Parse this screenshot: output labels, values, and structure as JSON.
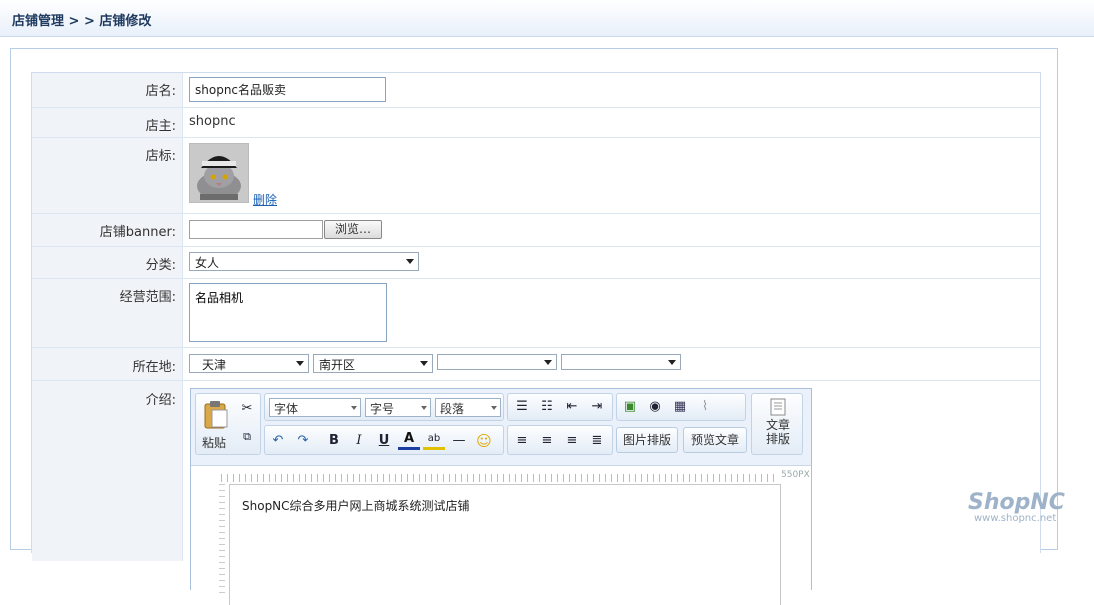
{
  "breadcrumb": "店铺管理 > > 店铺修改",
  "form": {
    "store_name": {
      "label": "店名:",
      "value": "shopnc名品贩卖"
    },
    "owner": {
      "label": "店主:",
      "value": "shopnc"
    },
    "logo": {
      "label": "店标:",
      "delete_link": "删除"
    },
    "banner": {
      "label": "店铺banner:",
      "browse_label": "浏览…"
    },
    "category": {
      "label": "分类:",
      "selected": "女人"
    },
    "scope": {
      "label": "经营范围:",
      "value": "名品相机"
    },
    "location": {
      "label": "所在地:",
      "province": "天津",
      "district": "南开区",
      "sub1": "",
      "sub2": ""
    },
    "intro": {
      "label": "介绍:"
    }
  },
  "editor": {
    "paste_label": "粘贴",
    "font_select": "字体",
    "size_select": "字号",
    "para_select": "段落",
    "image_layout_button": "图片排版",
    "preview_button": "预览文章",
    "article_layout_button": "文章\n排版",
    "ruler_label": "550PX",
    "content": "ShopNC综合多用户网上商城系统测试店铺"
  },
  "watermark": {
    "brand": "ShopNC",
    "site": "www.shopnc.net"
  },
  "colors": {
    "link": "#1a5fb4",
    "label_bg": "#f0f3f7",
    "border": "#b6cde6"
  }
}
